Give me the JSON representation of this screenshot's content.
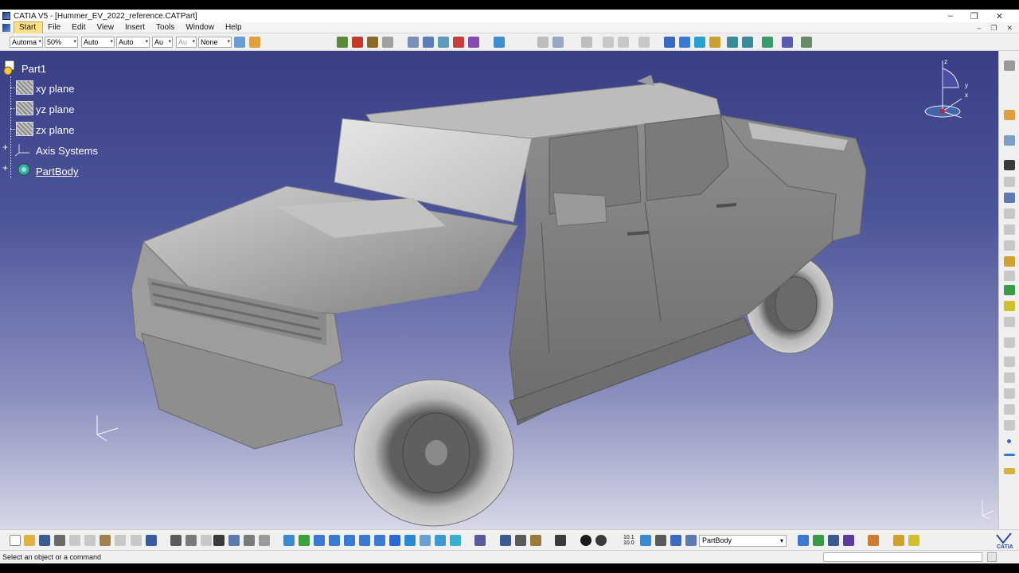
{
  "window": {
    "title": "CATIA V5 - [Hummer_EV_2022_reference.CATPart]",
    "controls": [
      "–",
      "❐",
      "✕"
    ]
  },
  "menu": {
    "items": [
      "Start",
      "File",
      "Edit",
      "View",
      "Insert",
      "Tools",
      "Window",
      "Help"
    ],
    "mdi_controls": [
      "–",
      "❐",
      "✕"
    ]
  },
  "toolbar_top": {
    "combos": [
      "Automa",
      "50%",
      "Auto",
      "Auto",
      "Au",
      "Au",
      "None"
    ]
  },
  "tree": {
    "root": "Part1",
    "items": [
      "xy plane",
      "yz plane",
      "zx plane",
      "Axis Systems",
      "PartBody"
    ]
  },
  "compass": {
    "labels": [
      "z",
      "y",
      "x"
    ]
  },
  "toolbar_bottom": {
    "partbody_select": "PartBody",
    "scale_label": "10.1\n10.0"
  },
  "status": {
    "message": "Select an object or a command"
  },
  "colors": {
    "viewport_top": "#393e85",
    "viewport_bottom": "#d7d8e6",
    "menu_active": "#ffe08a"
  }
}
